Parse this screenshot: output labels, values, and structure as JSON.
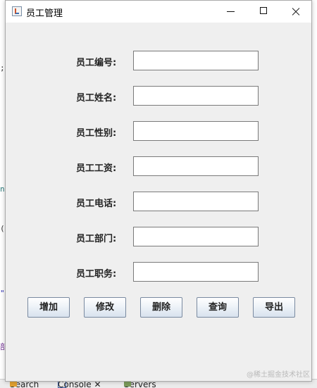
{
  "window": {
    "title": "员工管理"
  },
  "form": {
    "fields": [
      {
        "label": "员工编号:",
        "value": ""
      },
      {
        "label": "员工姓名:",
        "value": ""
      },
      {
        "label": "员工性别:",
        "value": ""
      },
      {
        "label": "员工工资:",
        "value": ""
      },
      {
        "label": "员工电话:",
        "value": ""
      },
      {
        "label": "员工部门:",
        "value": ""
      },
      {
        "label": "员工职务:",
        "value": ""
      }
    ]
  },
  "buttons": {
    "add": "增加",
    "edit": "修改",
    "delete": "删除",
    "query": "查询",
    "export": "导出"
  },
  "background": {
    "tabs": [
      "Search",
      "Console",
      "Servers"
    ],
    "watermark": "@稀土掘金技术社区"
  },
  "colors": {
    "window_bg": "#efefef",
    "button_gradient_end": "#d8e2ee"
  }
}
